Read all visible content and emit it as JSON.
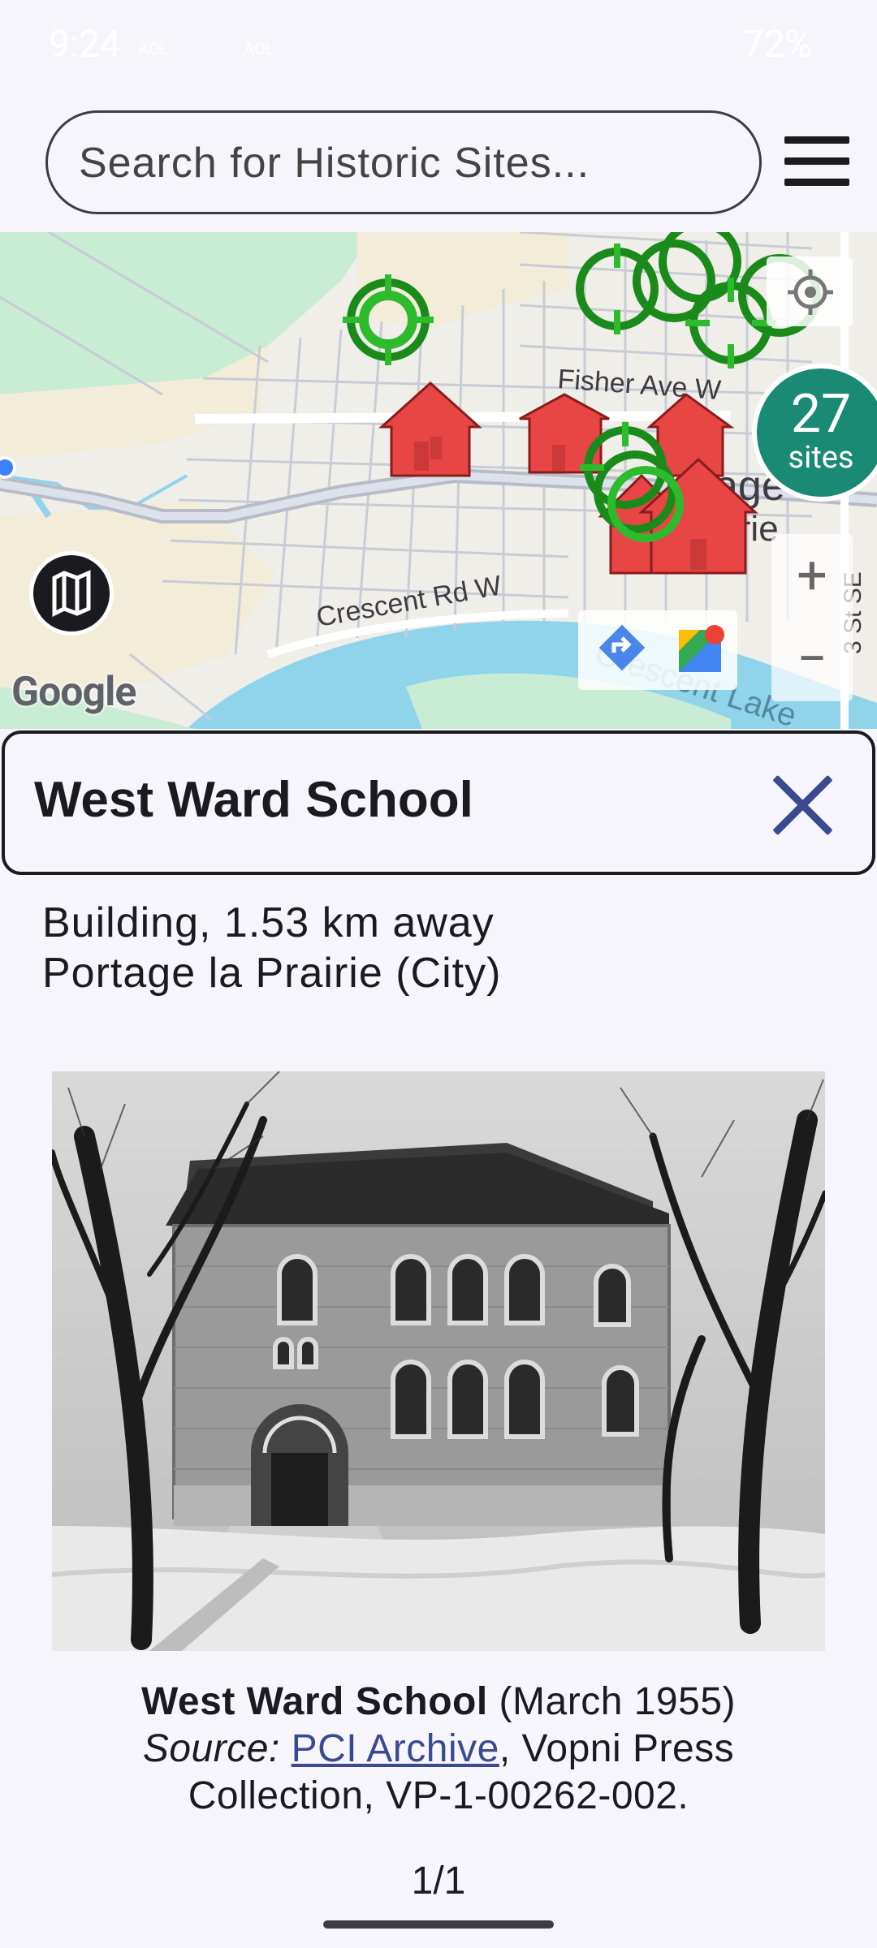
{
  "status_bar": {
    "time": "9:24",
    "carrier_left": "AOL",
    "carrier_right": "AOL",
    "battery": "72%"
  },
  "search": {
    "placeholder": "Search for Historic Sites..."
  },
  "map": {
    "street_labels": [
      "Fisher Ave W",
      "Crescent Rd W",
      "Crescent Lake",
      "3 St SE"
    ],
    "sites_count": "27",
    "sites_label": "sites",
    "zoom_in": "+",
    "zoom_out": "−",
    "attribution": "Google",
    "partial_labels": [
      "age",
      "irie"
    ]
  },
  "site": {
    "title": "West Ward School",
    "type_distance": "Building, 1.53 km away",
    "municipality": "Portage la Prairie (City)"
  },
  "caption": {
    "title": "West Ward School",
    "date": "(March 1955)",
    "source_label": "Source:",
    "source_link": "PCI Archive",
    "source_rest": ", Vopni Press",
    "collection": "Collection, VP-1-00262-002."
  },
  "pager": "1/1",
  "colors": {
    "marker_green": "#2dbb2d",
    "marker_red": "#e84545",
    "sites_badge": "#1a8a74",
    "link": "#3b4a8f",
    "water": "#8fd4ea",
    "park": "#c9ecd4"
  }
}
